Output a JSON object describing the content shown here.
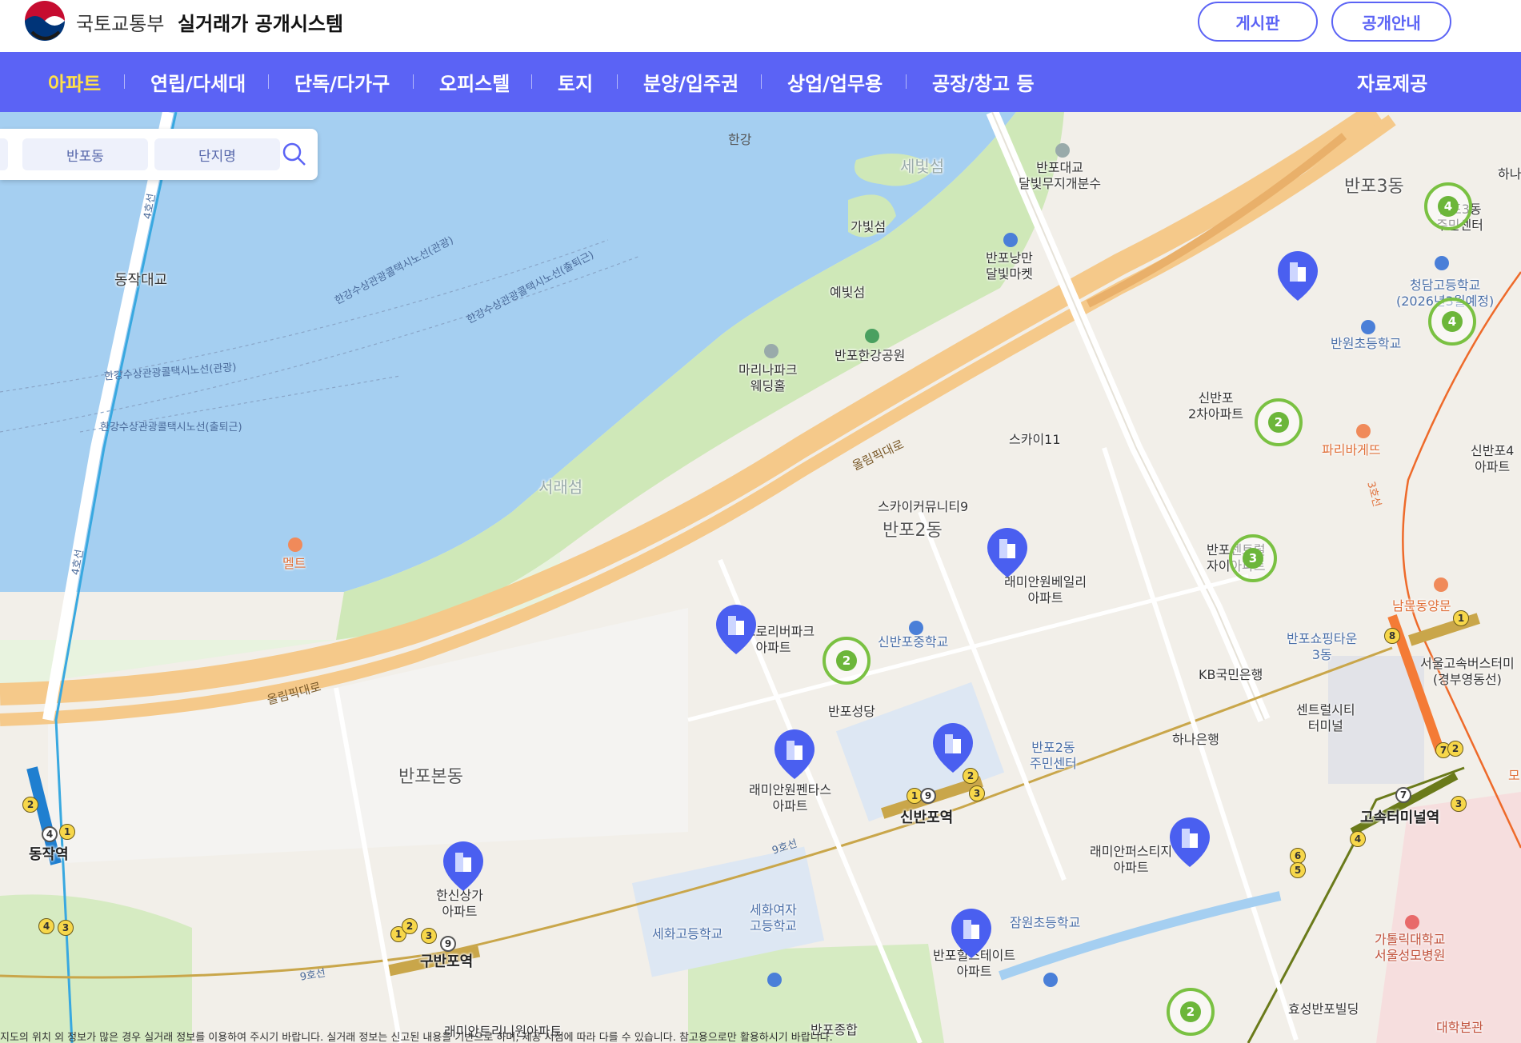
{
  "header": {
    "ministry": "국토교통부",
    "system_title": "실거래가 공개시스템",
    "board_button": "게시판",
    "guide_button": "공개안내"
  },
  "nav": {
    "items": [
      {
        "label": "아파트",
        "active": true
      },
      {
        "label": "연립/다세대",
        "active": false
      },
      {
        "label": "단독/다가구",
        "active": false
      },
      {
        "label": "오피스텔",
        "active": false
      },
      {
        "label": "토지",
        "active": false
      },
      {
        "label": "분양/입주권",
        "active": false
      },
      {
        "label": "상업/업무용",
        "active": false
      },
      {
        "label": "공장/창고 등",
        "active": false
      }
    ],
    "data_provision": "자료제공"
  },
  "search": {
    "dong": "반포동",
    "complex": "단지명",
    "search_icon": "search-icon"
  },
  "map": {
    "labels": {
      "hangang": "한강",
      "sebitseom": "세빛섬",
      "gabitseom": "가빛섬",
      "yebitseom": "예빛섬",
      "seoraeseom": "서래섬",
      "banpo_bridge_fountain": "반포대교\n달빛무지개분수",
      "banpo_moon_market": "반포낭만\n달빛마켓",
      "banpo_hangang_park": "반포한강공원",
      "marina_wedding": "마리나파크\n웨딩홀",
      "dongjak_bridge": "동작대교",
      "ferry_1": "한강수상관광콜택시노선(관광)",
      "ferry_2": "한강수상관광콜택시노선(출퇴근)",
      "ferry_3": "한강수상관광콜택시노선(관광)",
      "ferry_4": "한강수상관광콜택시노선(출퇴근)",
      "ferry_5": "한강수상관광콜택시노선(관광)",
      "ferry_6": "한강수상관광콜택시노선(출퇴근)",
      "olympic_road_1": "올림픽대로",
      "olympic_road_2": "올림픽대로",
      "melt": "멜트",
      "line4_a": "4호선",
      "line4_b": "4호선",
      "line9_a": "9호선",
      "line9_b": "9호선",
      "line3": "3호선",
      "banpo3dong": "반포3동",
      "banpo2dong": "반포2동",
      "banpobondong": "반포본동",
      "sky11": "스카이11",
      "sky_community9": "스카이커뮤니티9",
      "sinbanpo2": "신반포\n2차아파트",
      "paris_baguette": "파리바게뜨",
      "sinbanpo4": "신반포4\n아파트",
      "banwon_elem": "반원초등학교",
      "cheongdam_high": "청담고등학교\n(2026년3월예정)",
      "banpo3_center": "반포3동\n주민센터",
      "hana_top": "하나",
      "banpo_central_xi": "반포센트럴\n자이아파트",
      "raemian_belleza": "래미안원베일리\n아파트",
      "glory_riverpark": "아크로리버파크\n아파트",
      "sinbanpo_mid": "신반포중학교",
      "banpo_church": "반포성당",
      "kb_bank": "KB국민은행",
      "hana_bank": "하나은행",
      "banpo_shopping": "반포쇼핑타운\n3동",
      "express_bus": "서울고속버스터미\n(경부영동선)",
      "central_city": "센트럴시티\n터미널",
      "nambu_gate": "남문동양문",
      "banpo2_center": "반포2동\n주민센터",
      "raemian_pentas": "래미안원펜타스\n아파트",
      "sinbanpo_station": "신반포역",
      "express_terminal": "고속터미널역",
      "raemian_first": "래미안퍼스티지\n아파트",
      "dongjak_station": "동작역",
      "hanshin_sangga": "한신상가\n아파트",
      "gubanpo_station": "구반포역",
      "sehwa_high": "세화고등학교",
      "sehwa_girls": "세화여자\n고등학교",
      "jamwon_elem": "잠원초등학교",
      "banpo_hillstate": "반포힐스테이트\n아파트",
      "raemian_trinity": "래미안트리니원아파트",
      "banpo_sports": "반포종합",
      "hyosung_bldg": "효성반포빌딩",
      "catholic_univ": "가톨릭대학교\n서울성모병원",
      "univ_main": "대학본관",
      "mo_label": "모"
    },
    "clusters": [
      "4",
      "4",
      "2",
      "3",
      "2",
      "2"
    ],
    "colors": {
      "cluster": "#7ac142",
      "apt_marker": "#4a5ff0",
      "nav": "#5b63f5",
      "active_nav": "#ffe04a"
    }
  },
  "footer_note": "지도의 위치 외 정보가 많은 경우 실거래 정보를 이용하여 주시기 바랍니다. 실거래 정보는 신고된 내용을 기반으로 하며, 제공 시점에 따라 다를 수 있습니다. 참고용으로만 활용하시기 바랍니다."
}
